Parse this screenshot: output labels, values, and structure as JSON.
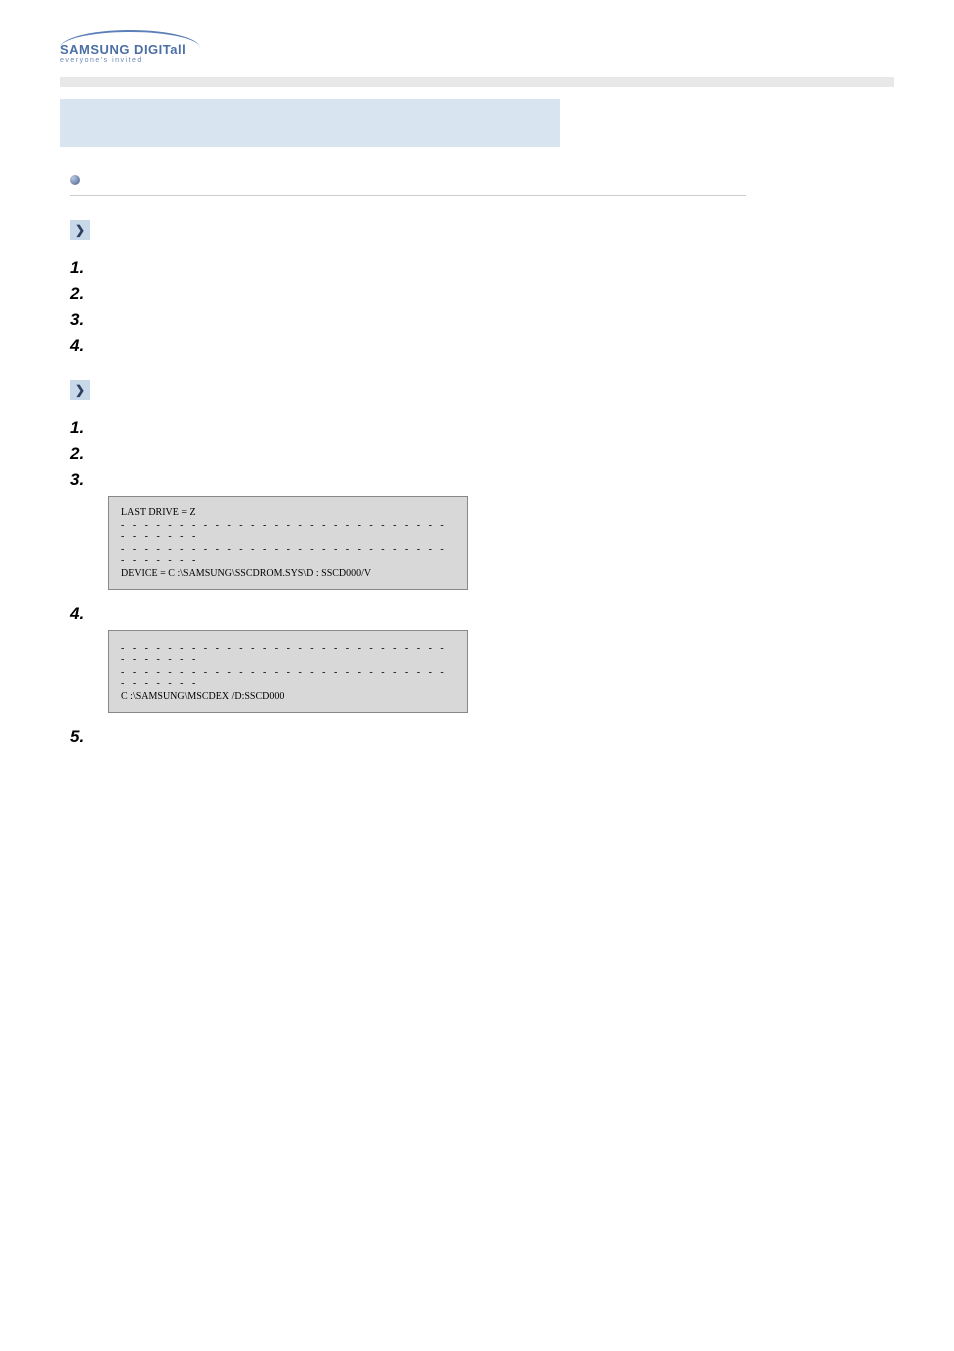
{
  "logo": {
    "main": "SAMSUNG DIGITall",
    "tagline": "everyone's invited"
  },
  "codebox1": {
    "line1": "LAST DRIVE = Z",
    "line2": "- - - - - - - - - - - - - - - - - - - - - - - - - - - - - - - - - - -",
    "line3": "- - - - - - - - - - - - - - - - - - - - - - - - - - - - - - - - - - -",
    "line4": "DEVICE = C :\\SAMSUNG\\SSCDROM.SYS\\D : SSCD000/V"
  },
  "codebox2": {
    "line1": "- - - - - - - - - - - - - - - - - - - - - - - - - - - - - - - - - - -",
    "line2": "- - - - - - - - - - - - - - - - - - - - - - - - - - - - - - - - - - -",
    "line3": "C :\\SAMSUNG\\MSCDEX /D:SSCD000"
  },
  "steps": {
    "s1": "1.",
    "s2": "2.",
    "s3": "3.",
    "s4": "4.",
    "s5": "5."
  }
}
